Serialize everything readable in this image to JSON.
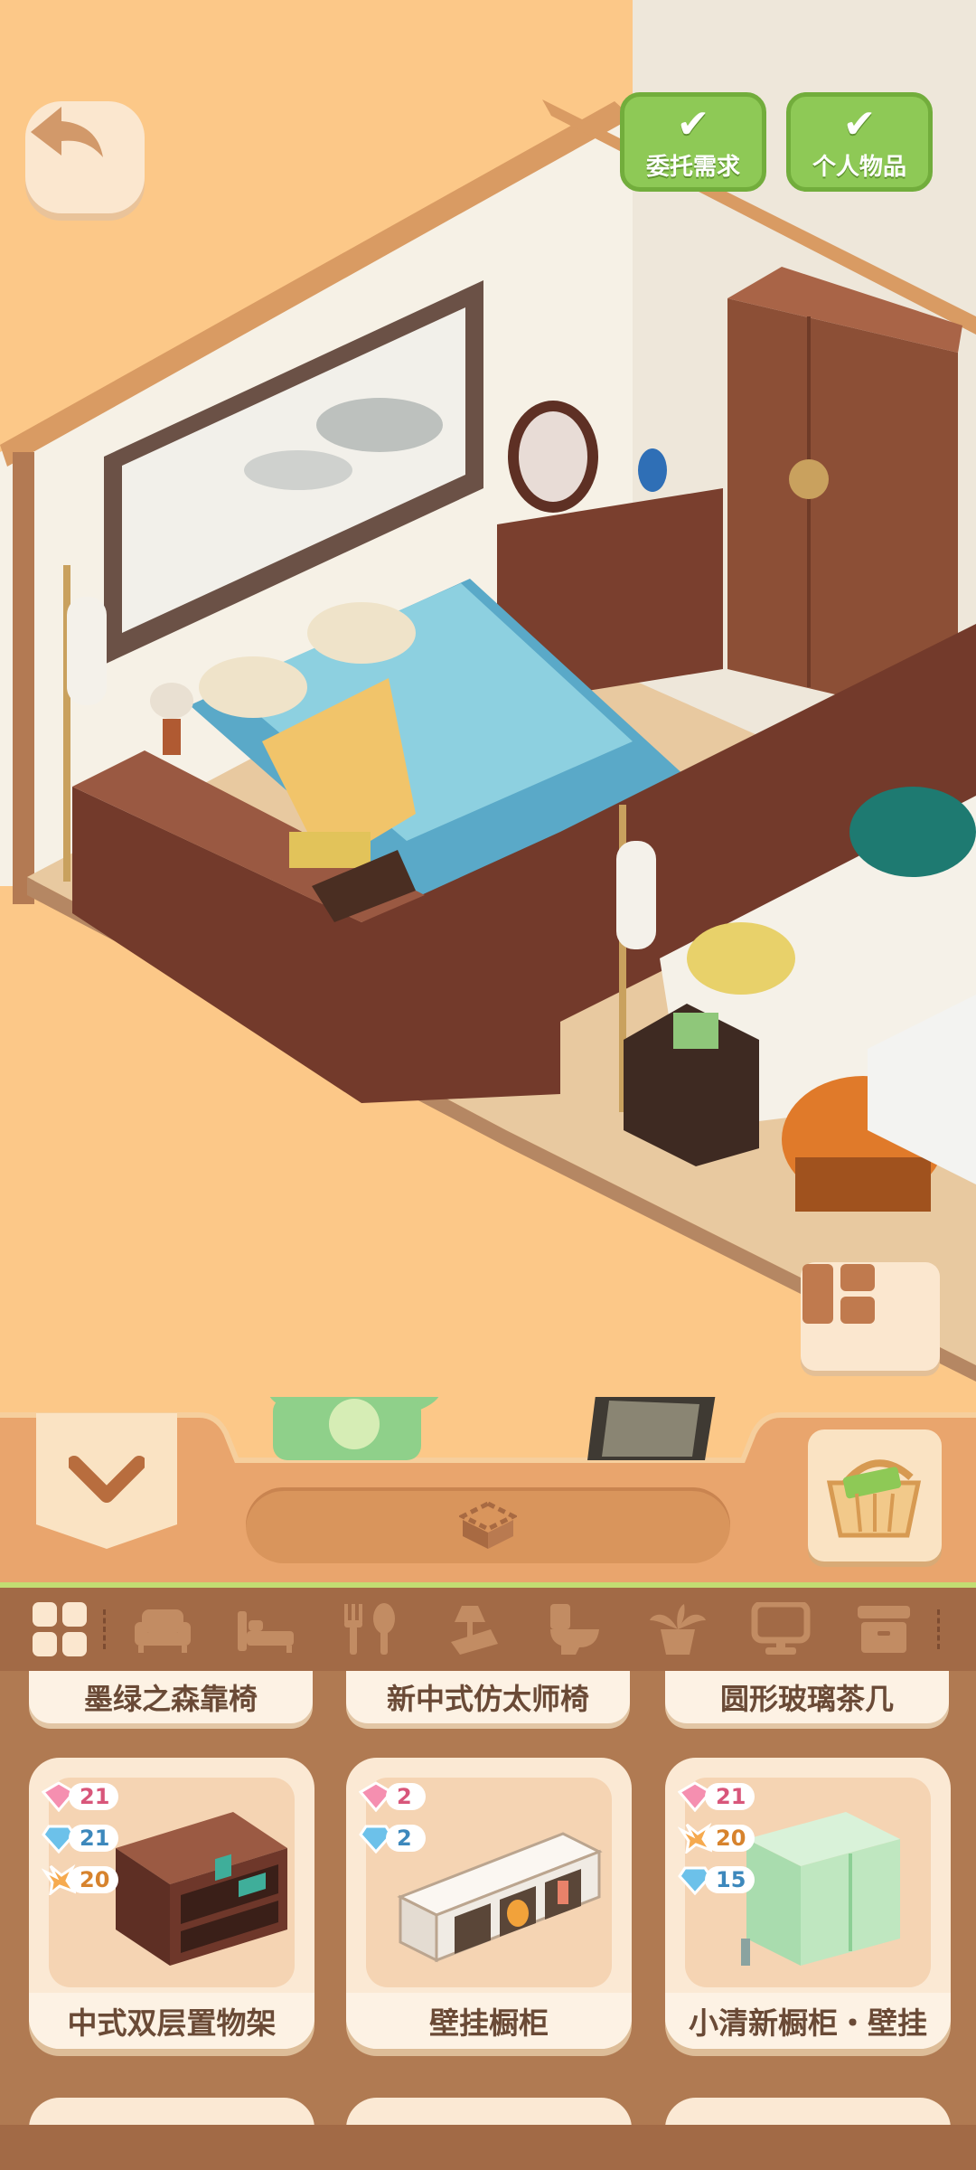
{
  "scene": {
    "filters": [
      {
        "label": "委托需求",
        "checked": true
      },
      {
        "label": "个人物品",
        "checked": true
      }
    ]
  },
  "toolbar": {
    "icons": [
      "back-arrow-icon",
      "collapse-chevron-icon",
      "rotate-icon",
      "basket-icon",
      "layout-icon"
    ]
  },
  "categories": [
    {
      "icon": "all-grid-icon",
      "active": true
    },
    {
      "icon": "sofa-icon"
    },
    {
      "icon": "bed-icon"
    },
    {
      "icon": "dining-icon"
    },
    {
      "icon": "decor-icon"
    },
    {
      "icon": "toilet-icon"
    },
    {
      "icon": "plant-icon"
    },
    {
      "icon": "monitor-icon"
    },
    {
      "icon": "cabinet-icon"
    }
  ],
  "items_prev_row": [
    "墨绿之森靠椅",
    "新中式仿太师椅",
    "圆形玻璃茶几"
  ],
  "items": [
    {
      "name": "中式双层置物架",
      "costs": [
        {
          "type": "pink",
          "value": "21"
        },
        {
          "type": "blue",
          "value": "21"
        },
        {
          "type": "orange",
          "value": "20"
        }
      ]
    },
    {
      "name": "壁挂橱柜",
      "costs": [
        {
          "type": "pink",
          "value": "2"
        },
        {
          "type": "blue",
          "value": "2"
        }
      ]
    },
    {
      "name": "小清新橱柜・壁挂",
      "costs": [
        {
          "type": "pink",
          "value": "21"
        },
        {
          "type": "orange",
          "value": "20"
        },
        {
          "type": "blue",
          "value": "15"
        }
      ]
    }
  ],
  "colors": {
    "background": "#fcc888",
    "panel": "#a26a46",
    "accent_green": "#8ec956",
    "card": "#fbe9d4",
    "text": "#6a4a36"
  }
}
